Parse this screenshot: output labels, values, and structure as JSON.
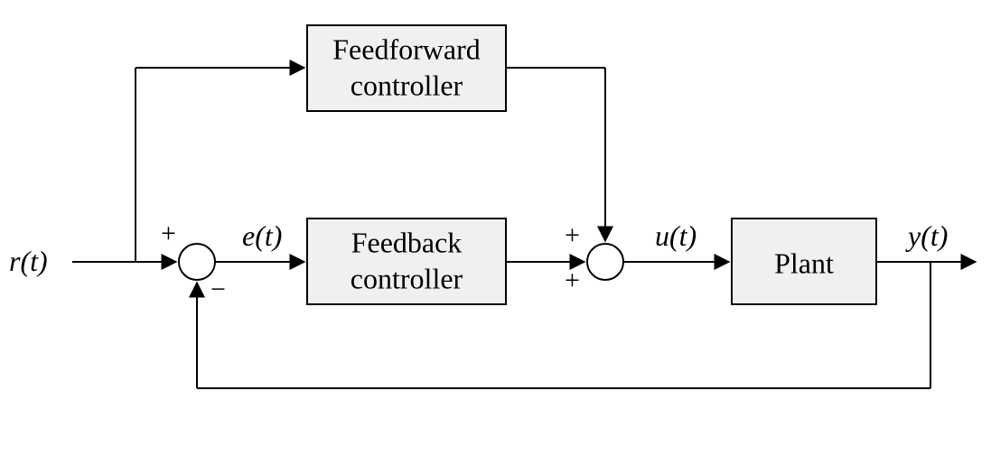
{
  "signals": {
    "reference": "r(t)",
    "error": "e(t)",
    "control": "u(t)",
    "output": "y(t)"
  },
  "blocks": {
    "feedforward_line1": "Feedforward",
    "feedforward_line2": "controller",
    "feedback_line1": "Feedback",
    "feedback_line2": "controller",
    "plant": "Plant"
  },
  "signs": {
    "sum1_top": "+",
    "sum1_bottom": "−",
    "sum2_top": "+",
    "sum2_left": "+"
  }
}
